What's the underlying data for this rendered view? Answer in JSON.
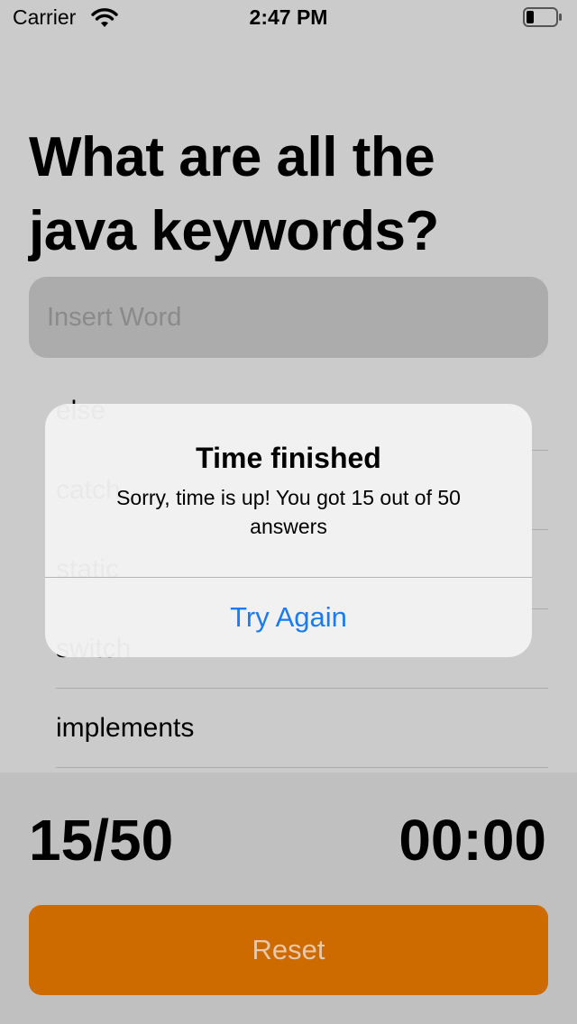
{
  "status_bar": {
    "carrier": "Carrier",
    "time": "2:47 PM"
  },
  "question": "What are all the java keywords?",
  "input": {
    "placeholder": "Insert Word",
    "value": ""
  },
  "answers": [
    "else",
    "catch",
    "static",
    "switch",
    "implements"
  ],
  "score": "15/50",
  "timer": "00:00",
  "reset_label": "Reset",
  "alert": {
    "title": "Time finished",
    "message": "Sorry, time is up! You got 15 out of 50 answers",
    "button": "Try Again"
  },
  "colors": {
    "accent": "#cd6a00",
    "link": "#1a7cf0",
    "background": "#cbcbcb"
  }
}
